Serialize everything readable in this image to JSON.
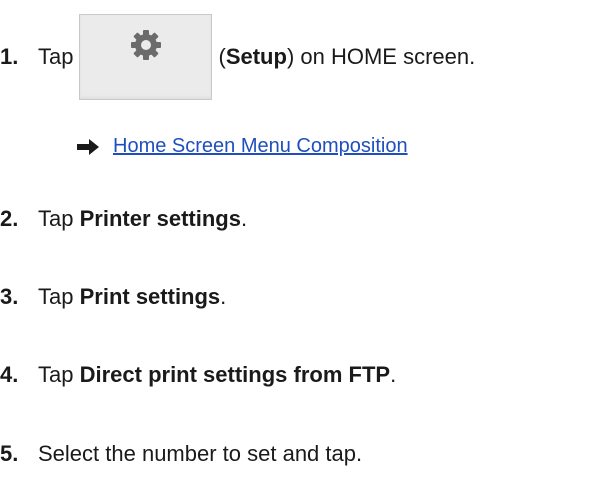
{
  "steps": [
    {
      "number": "1.",
      "before": "Tap",
      "paren_open": "(",
      "bold": "Setup",
      "after": ") on HOME screen.",
      "button_icon": "gear-icon",
      "link": {
        "arrow_icon": "right-arrow-icon",
        "text": "Home Screen Menu Composition"
      }
    },
    {
      "number": "2.",
      "before": "Tap ",
      "bold": "Printer settings",
      "after": "."
    },
    {
      "number": "3.",
      "before": "Tap ",
      "bold": "Print settings",
      "after": "."
    },
    {
      "number": "4.",
      "before": "Tap ",
      "bold": "Direct print settings from FTP",
      "after": "."
    },
    {
      "number": "5.",
      "text": "Select the number to set and tap."
    }
  ]
}
